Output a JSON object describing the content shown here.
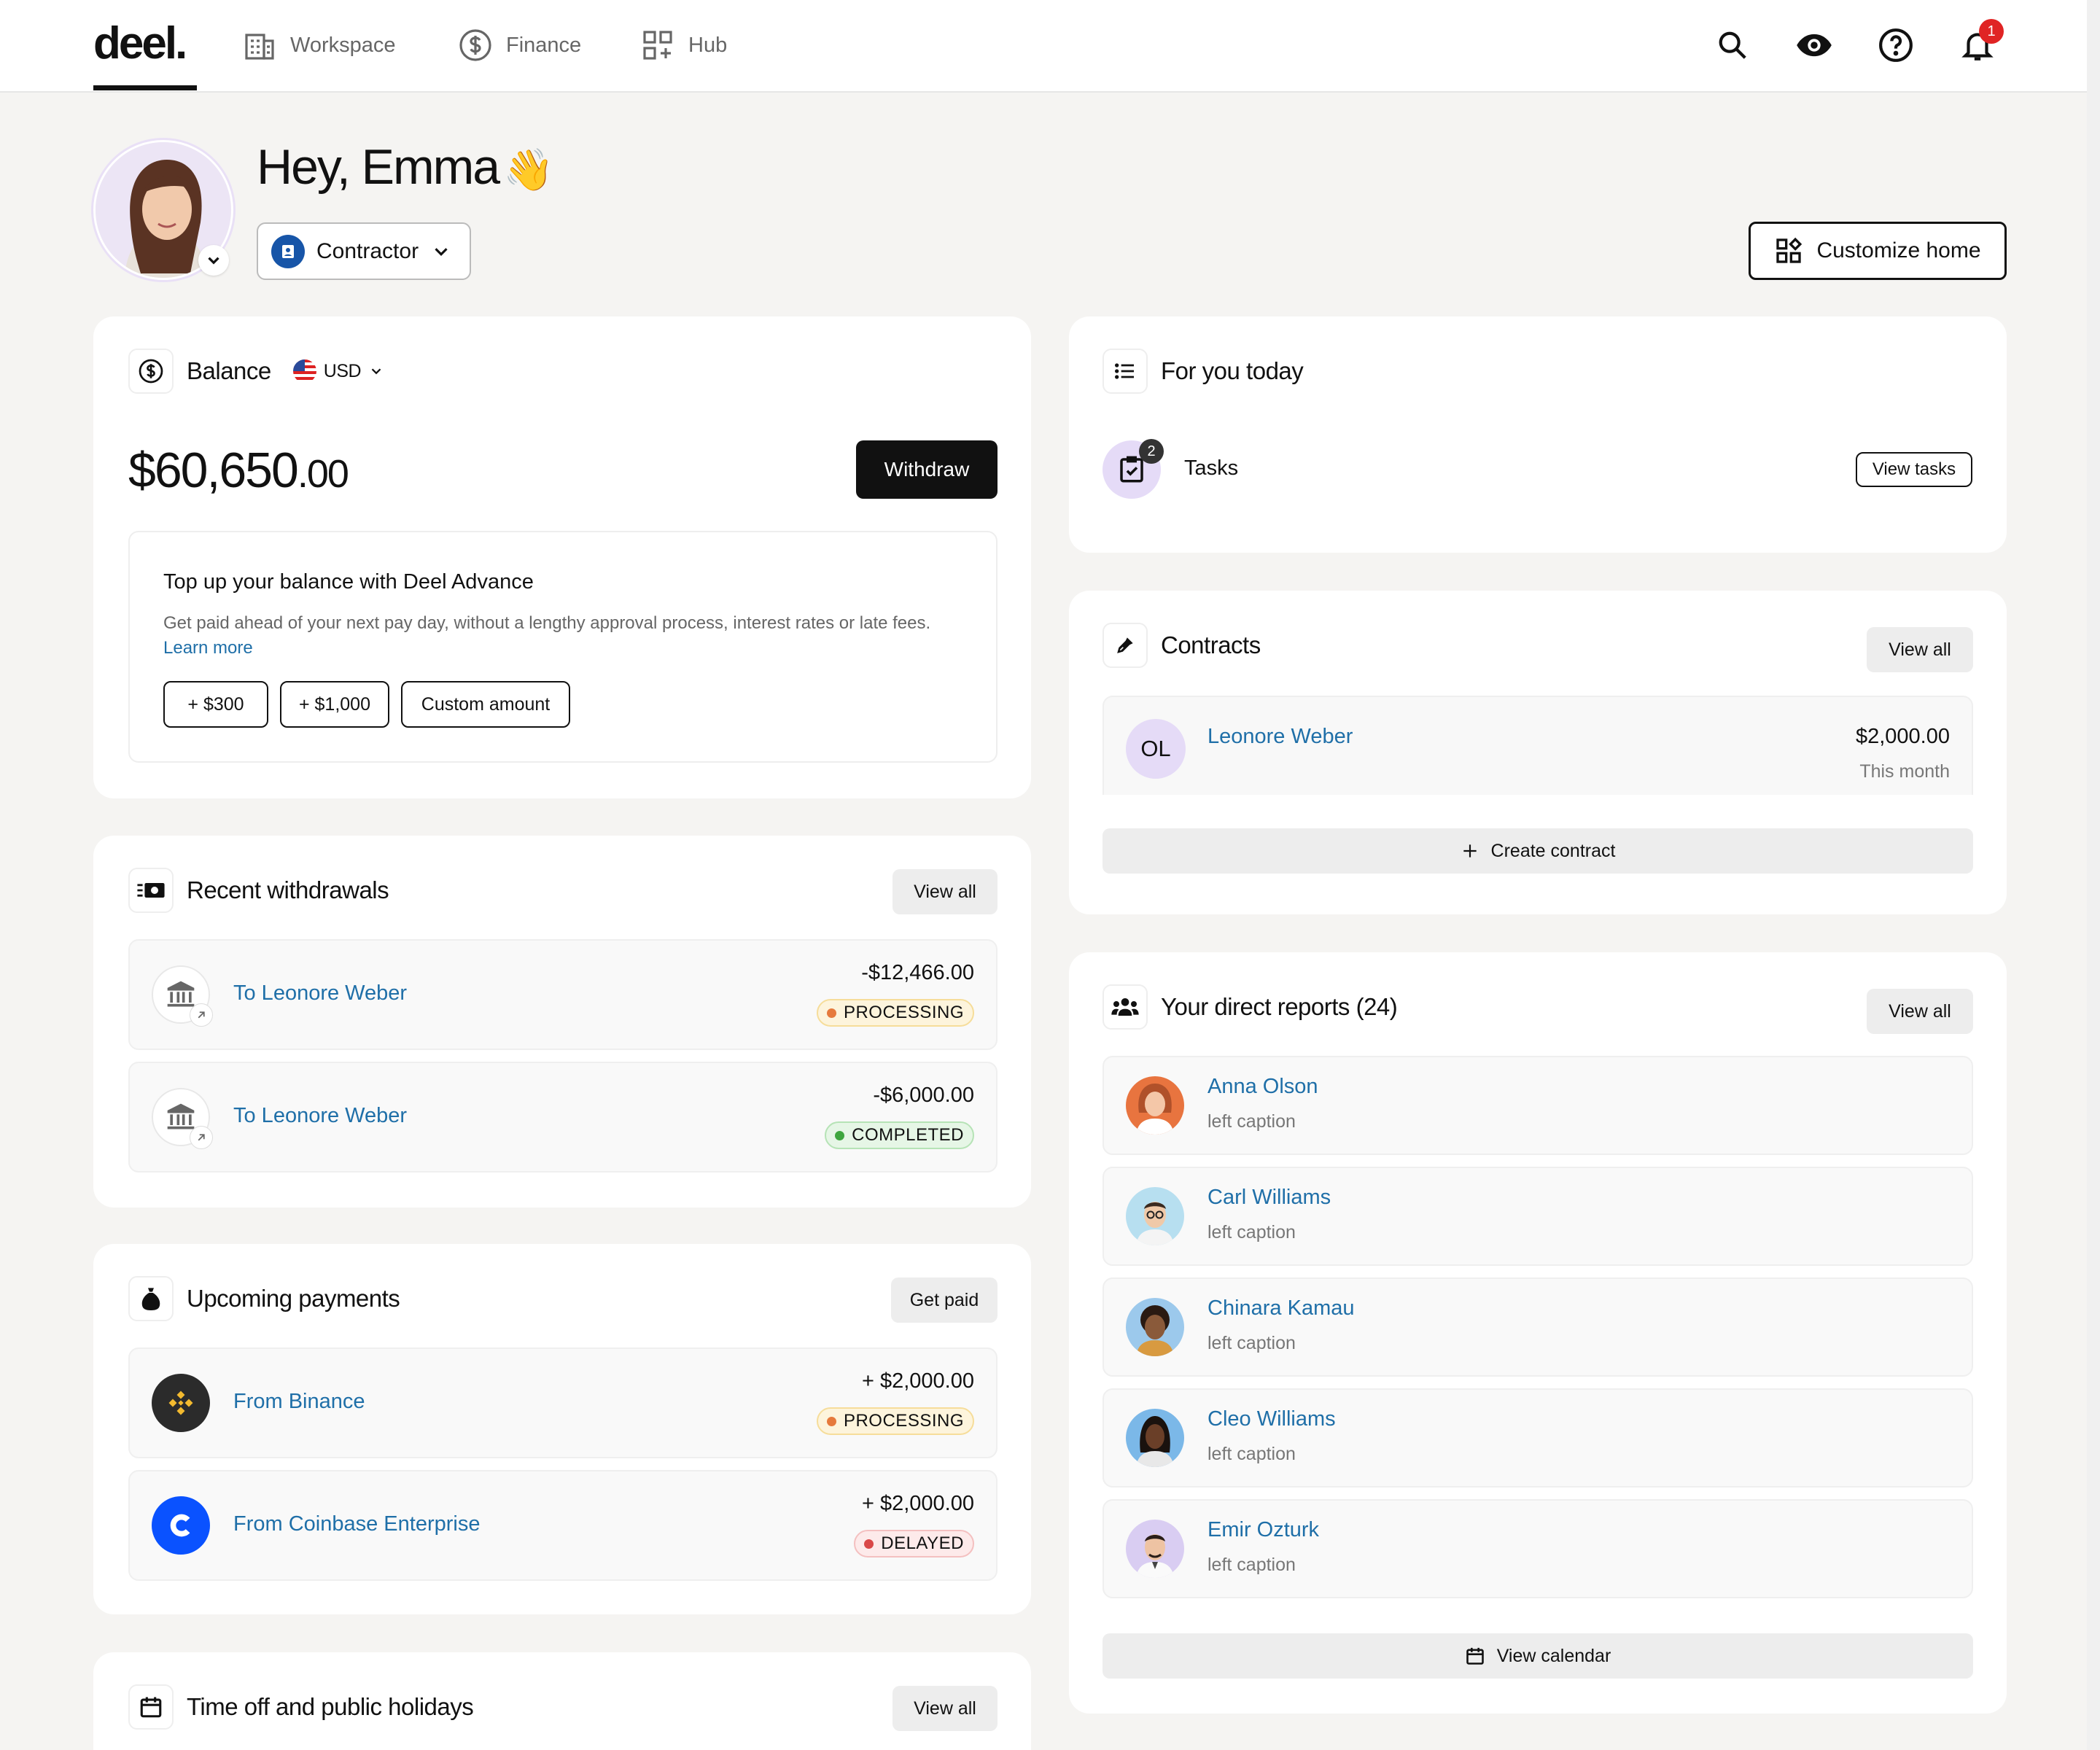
{
  "nav": {
    "logo": "deel.",
    "items": [
      {
        "label": "Workspace"
      },
      {
        "label": "Finance"
      },
      {
        "label": "Hub"
      }
    ],
    "notifications": "1"
  },
  "header": {
    "greeting": "Hey, Emma",
    "wave": "👋",
    "role": "Contractor",
    "customize": "Customize home"
  },
  "balance": {
    "title": "Balance",
    "currency": "USD",
    "amount_main": "$60,650",
    "amount_cents": ".00",
    "withdraw": "Withdraw",
    "advance_title": "Top up your balance with Deel Advance",
    "advance_desc": "Get paid ahead of your next pay day, without a lengthy approval process, interest rates or late fees.",
    "learn_more": "Learn more",
    "options": [
      "+ $300",
      "+ $1,000",
      "Custom amount"
    ]
  },
  "withdrawals": {
    "title": "Recent withdrawals",
    "view_all": "View all",
    "items": [
      {
        "name": "To Leonore Weber",
        "amount": "-$12,466.00",
        "status": "PROCESSING"
      },
      {
        "name": "To Leonore Weber",
        "amount": "-$6,000.00",
        "status": "COMPLETED"
      }
    ]
  },
  "payments": {
    "title": "Upcoming payments",
    "action": "Get paid",
    "items": [
      {
        "name": "From Binance",
        "amount": "+ $2,000.00",
        "status": "PROCESSING"
      },
      {
        "name": "From Coinbase Enterprise",
        "amount": "+ $2,000.00",
        "status": "DELAYED"
      }
    ]
  },
  "timeoff": {
    "title": "Time off and public holidays",
    "view_all": "View all"
  },
  "today": {
    "title": "For you today",
    "tasks_label": "Tasks",
    "tasks_count": "2",
    "view_tasks": "View tasks"
  },
  "contracts": {
    "title": "Contracts",
    "view_all": "View all",
    "initials": "OL",
    "name": "Leonore Weber",
    "amount": "$2,000.00",
    "period": "This month",
    "create": "Create contract"
  },
  "reports": {
    "title": "Your direct reports (24)",
    "view_all": "View all",
    "items": [
      {
        "name": "Anna Olson",
        "caption": "left caption"
      },
      {
        "name": "Carl Williams",
        "caption": "left caption"
      },
      {
        "name": "Chinara Kamau",
        "caption": "left caption"
      },
      {
        "name": "Cleo Williams",
        "caption": "left caption"
      },
      {
        "name": "Emir Ozturk",
        "caption": "left caption"
      }
    ],
    "calendar": "View calendar"
  },
  "colors": {
    "link": "#1f6fa8",
    "processing": "#fdf4dc",
    "completed": "#e6f6e6",
    "delayed": "#fdeaea",
    "accent": "#111111"
  }
}
